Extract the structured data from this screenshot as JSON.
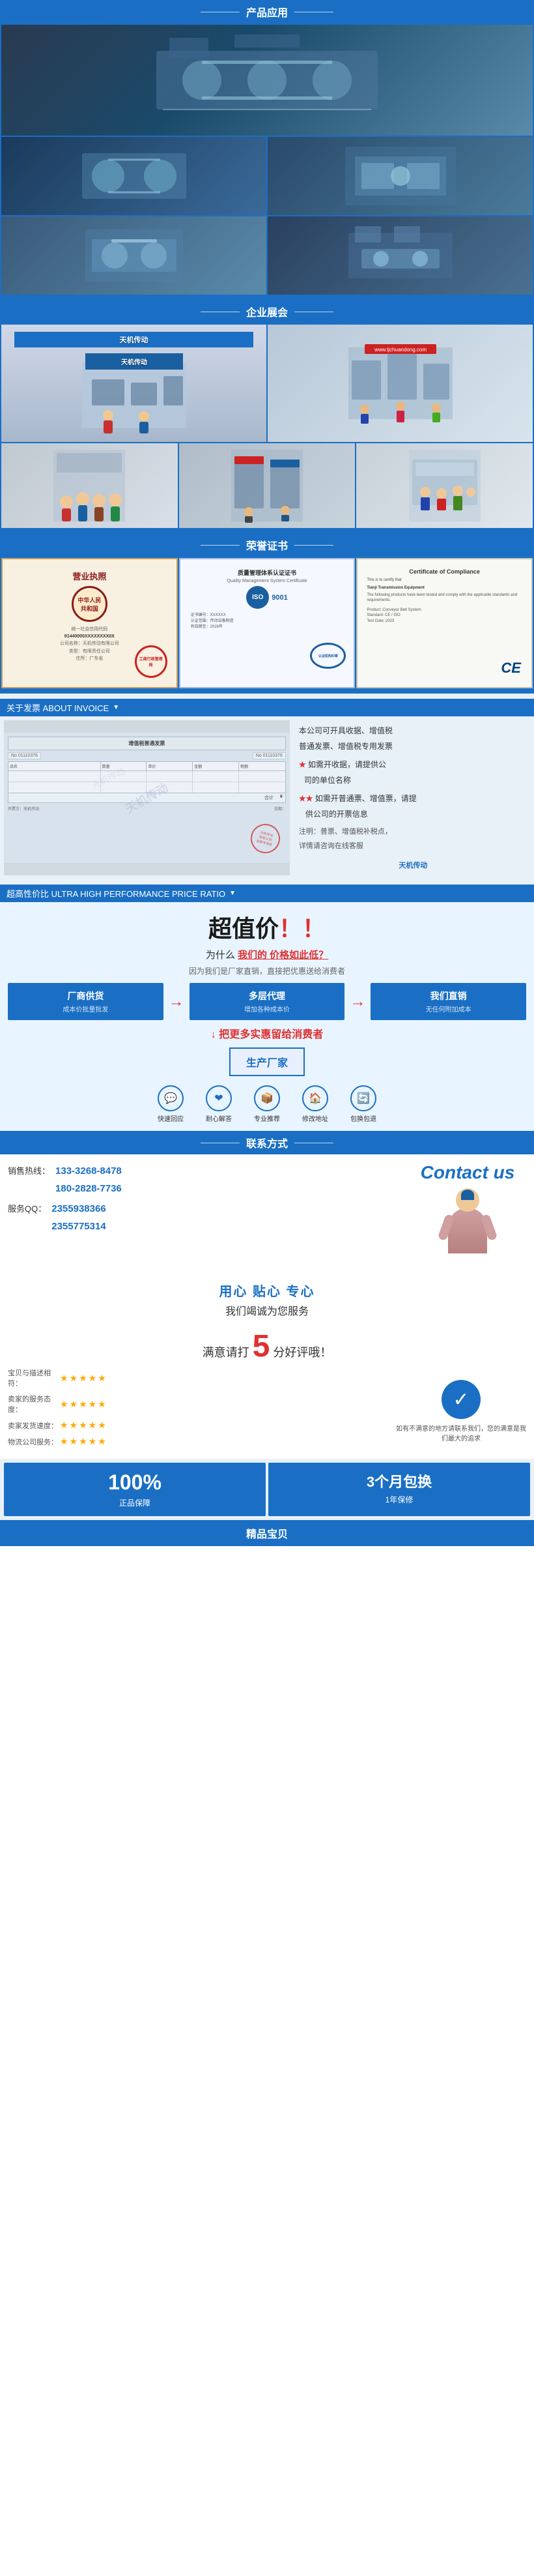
{
  "sections": {
    "product_app": {
      "title": "产品应用"
    },
    "exhibition": {
      "title": "企业展会"
    },
    "honor": {
      "title": "荣誉证书"
    },
    "invoice": {
      "title": "关于发票 ABOUT INVOICE",
      "text1": "本公司可开具收据、增值税",
      "text1b": "普通发票、增值税专用发票",
      "text2_star": "★",
      "text2": "如需开收据，请提供公",
      "text2b": "司的单位名称",
      "text3_star": "★★",
      "text3": "如需开普通票、增值票，请提",
      "text3b": "供公司的开票信息",
      "text4": "注明：普票、增值税补税点，",
      "text4b": "详情请咨询在线客服",
      "watermark": "天机传动"
    },
    "price": {
      "title": "超高性价比 ULTRA HIGH PERFORMANCE PRICE RATIO",
      "main_title": "超值价！！",
      "question": "为什么 我们的 价格如此低？",
      "sub": "因为我们是厂家直销，直接把优惠送给消费者",
      "cards": [
        {
          "title": "厂商供货",
          "sub": "成本价批量批发"
        },
        {
          "title": "多层代理",
          "sub": "增加各种成本价"
        },
        {
          "title": "我们直销",
          "sub": "无任何附加成本"
        }
      ],
      "factory": "生产厂家",
      "services": [
        {
          "icon": "💬",
          "label": "快速回应"
        },
        {
          "icon": "❤",
          "label": "耐心解答"
        },
        {
          "icon": "📦",
          "label": "专业推荐"
        },
        {
          "icon": "🏠",
          "label": "修改地址"
        },
        {
          "icon": "🔄",
          "label": "包换包退"
        }
      ]
    },
    "contact": {
      "title": "联系方式",
      "hotline_label": "销售热线：",
      "hotline1": "133-3268-8478",
      "hotline2": "180-2828-7736",
      "qq_label": "服务QQ：",
      "qq1": "2355938366",
      "qq2": "2355775314",
      "contact_us": "Contact us",
      "slogan1": "用心 贴心 专心",
      "slogan2": "我们竭诚为您服务"
    },
    "rating": {
      "title_pre": "满意请打",
      "big_num": "5",
      "title_post": "分好评哦！",
      "rows": [
        {
          "label": "宝贝与描述相符：",
          "stars": "★★★★★"
        },
        {
          "label": "卖家的服务态度：",
          "stars": "★★★★★"
        },
        {
          "label": "卖家发货速度：",
          "stars": "★★★★★"
        },
        {
          "label": "物流公司服务：",
          "stars": "★★★★★"
        }
      ],
      "right_text": "如有不满意的地方请联系我们，您的满意是我们最大的追求",
      "checkmark": "✓"
    },
    "guarantee": [
      {
        "num": "100%",
        "label": "正品保障"
      },
      {
        "num": "3个月包换",
        "sub": "1年保修",
        "label": ""
      }
    ],
    "bottom": {
      "label": "精品宝贝"
    },
    "certs": [
      {
        "type": "business_license",
        "title": "营业执照"
      },
      {
        "type": "iso",
        "title": "质量管理体系认证证书"
      },
      {
        "type": "compliance",
        "title": "Certificate of Compliance"
      }
    ]
  }
}
